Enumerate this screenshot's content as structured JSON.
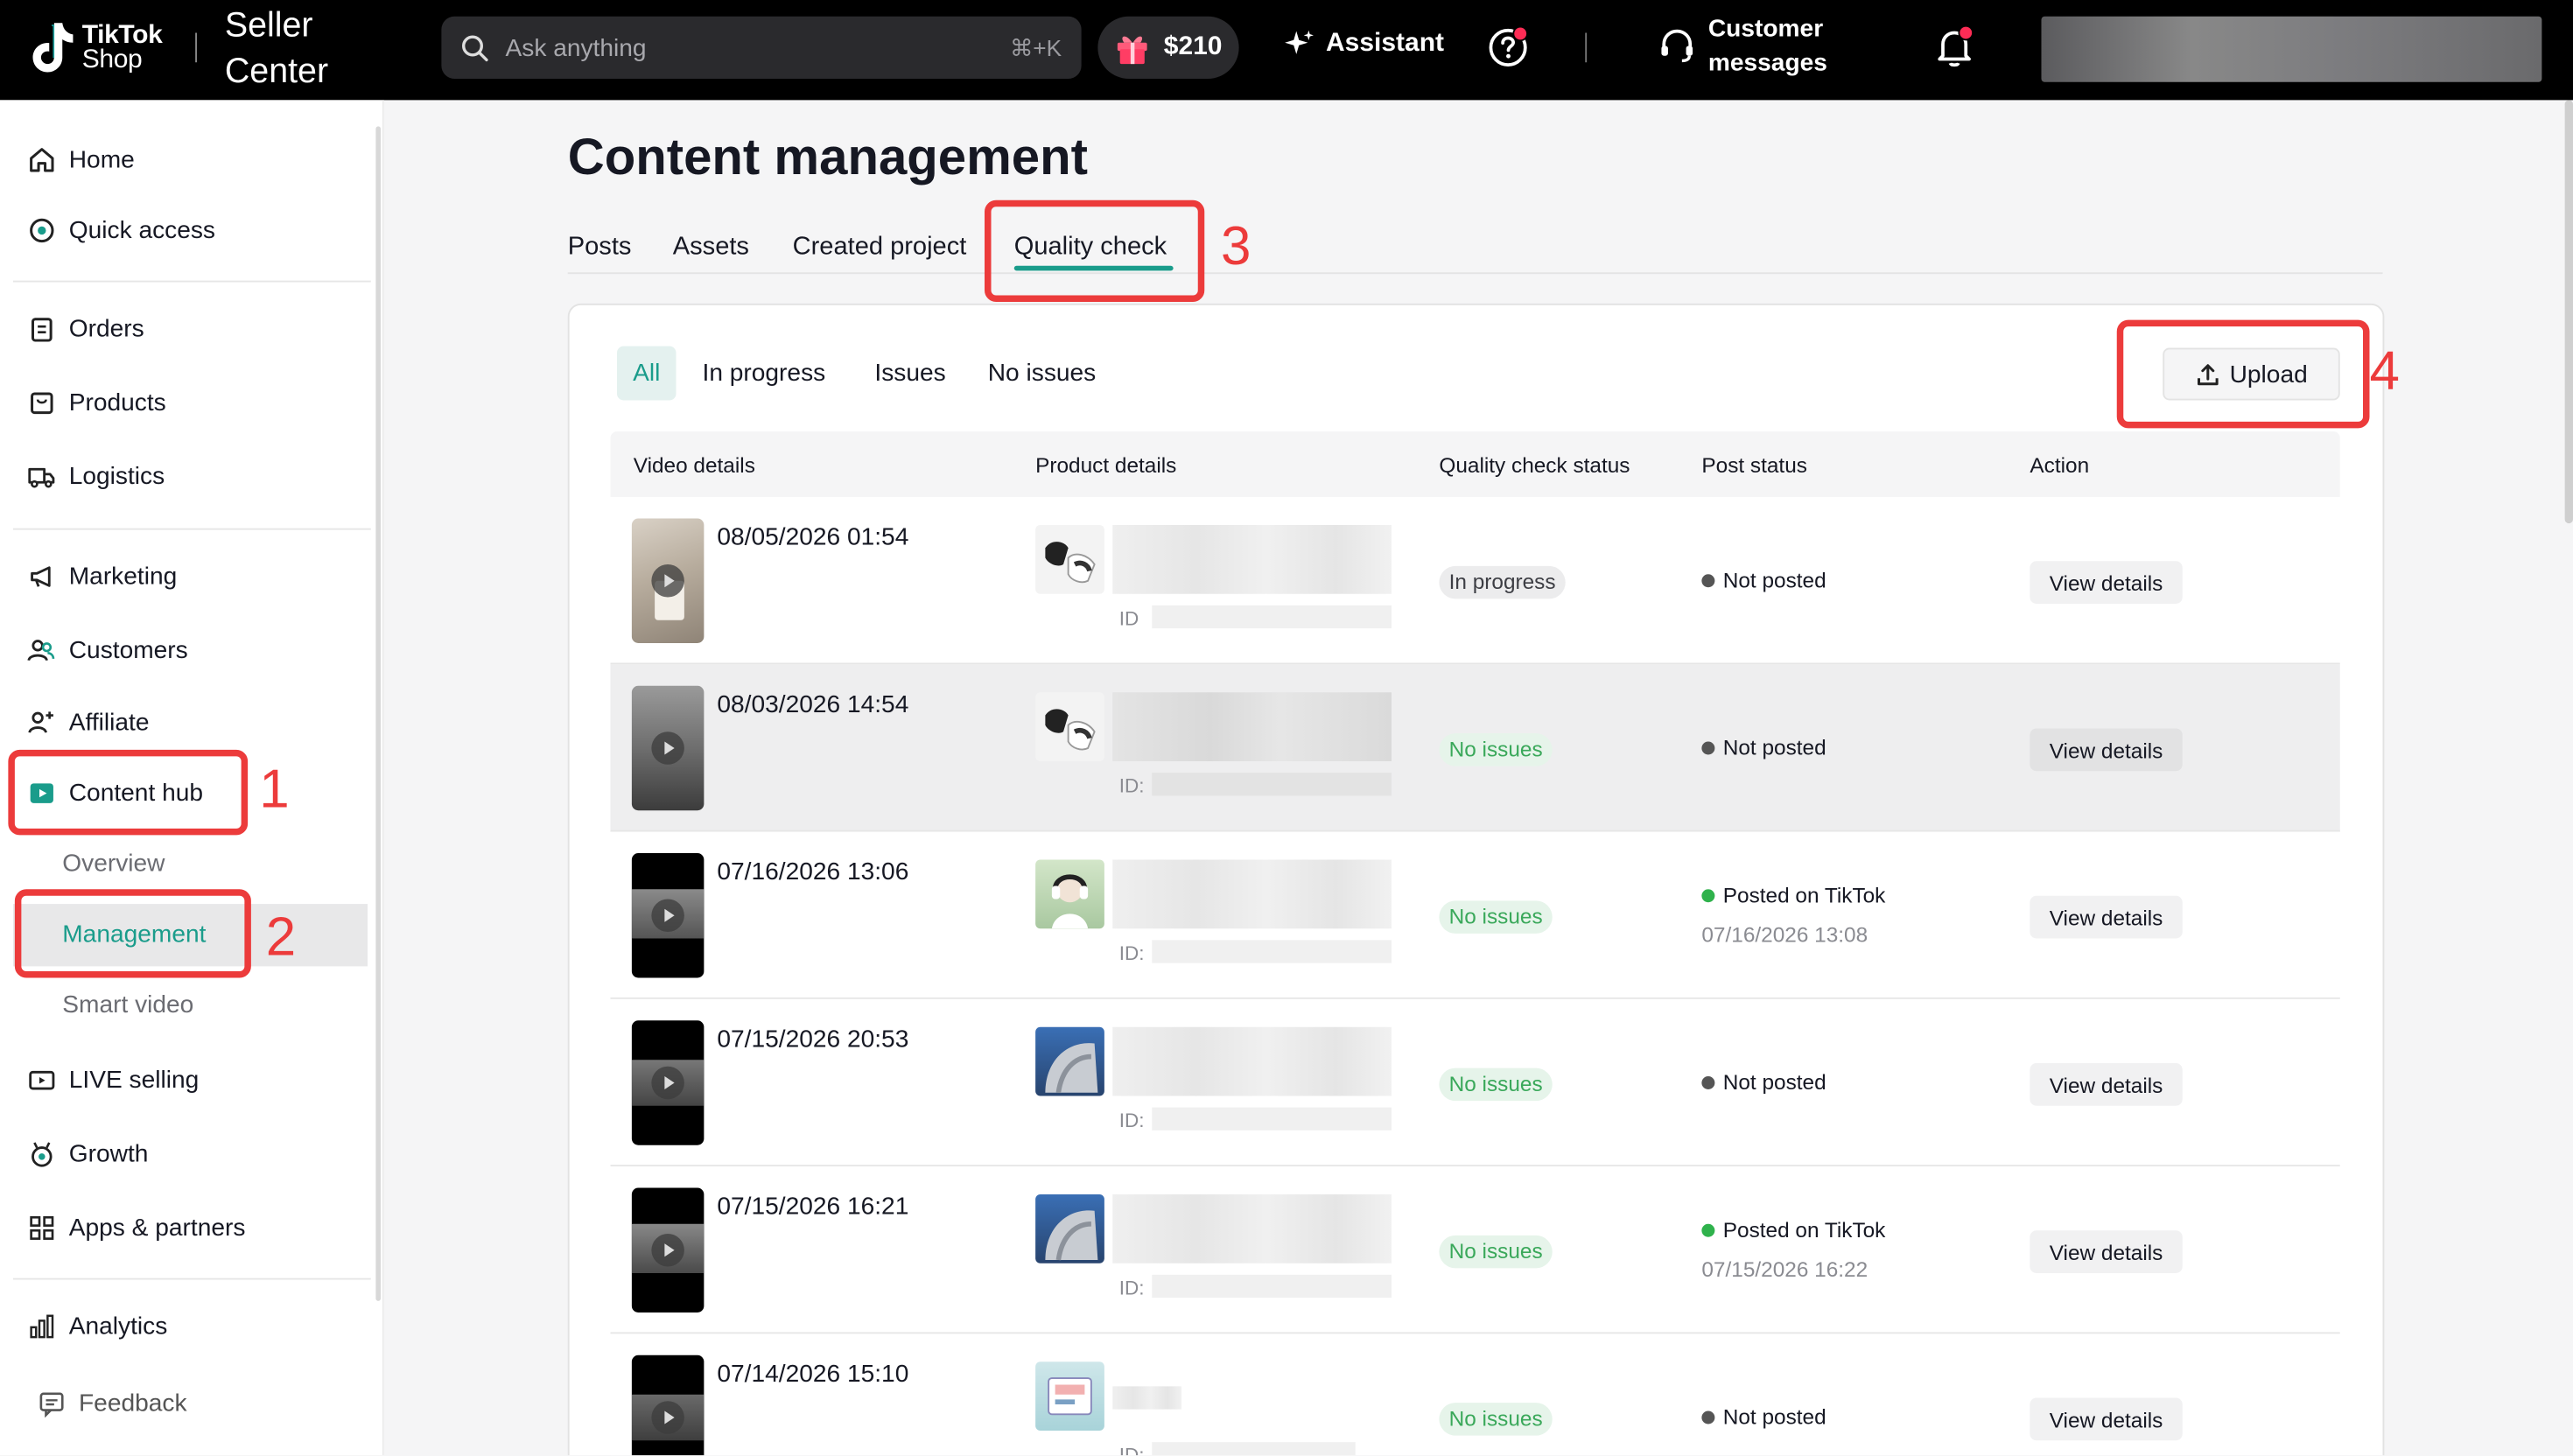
{
  "topbar": {
    "logo_line1": "TikTok",
    "logo_line2": "Shop",
    "seller_center_line1": "Seller",
    "seller_center_line2": "Center",
    "search_placeholder": "Ask anything",
    "search_shortcut": "⌘+K",
    "balance": "$210",
    "assistant": "Assistant",
    "customer_messages_line1": "Customer",
    "customer_messages_line2": "messages"
  },
  "sidebar": {
    "home": "Home",
    "quick_access": "Quick access",
    "orders": "Orders",
    "products": "Products",
    "logistics": "Logistics",
    "marketing": "Marketing",
    "customers": "Customers",
    "affiliate": "Affiliate",
    "content_hub": "Content hub",
    "overview": "Overview",
    "management": "Management",
    "smart_video": "Smart video",
    "live_selling": "LIVE selling",
    "growth": "Growth",
    "apps_partners": "Apps & partners",
    "analytics": "Analytics",
    "feedback": "Feedback"
  },
  "annotations": [
    "1",
    "2",
    "3",
    "4"
  ],
  "main": {
    "title": "Content management",
    "tabs": [
      "Posts",
      "Assets",
      "Created project",
      "Quality check"
    ],
    "active_tab": "Quality check",
    "filters": [
      "All",
      "In progress",
      "Issues",
      "No issues"
    ],
    "active_filter": "All",
    "upload": "Upload",
    "columns": [
      "Video details",
      "Product details",
      "Quality check status",
      "Post status",
      "Action"
    ],
    "rows": [
      {
        "date": "08/05/2026 01:54",
        "id_label": "ID",
        "qc_status": "In progress",
        "post_status": "Not posted",
        "post_time": "",
        "action": "View details"
      },
      {
        "date": "08/03/2026 14:54",
        "id_label": "ID:",
        "qc_status": "No issues",
        "post_status": "Not posted",
        "post_time": "",
        "action": "View details"
      },
      {
        "date": "07/16/2026 13:06",
        "id_label": "ID:",
        "qc_status": "No issues",
        "post_status": "Posted on TikTok",
        "post_time": "07/16/2026 13:08",
        "action": "View details"
      },
      {
        "date": "07/15/2026 20:53",
        "id_label": "ID:",
        "qc_status": "No issues",
        "post_status": "Not posted",
        "post_time": "",
        "action": "View details"
      },
      {
        "date": "07/15/2026 16:21",
        "id_label": "ID:",
        "qc_status": "No issues",
        "post_status": "Posted on TikTok",
        "post_time": "07/15/2026 16:22",
        "action": "View details"
      },
      {
        "date": "07/14/2026 15:10",
        "id_label": "ID:",
        "qc_status": "No issues",
        "post_status": "Not posted",
        "post_time": "",
        "action": "View details"
      }
    ]
  },
  "colors": {
    "accent": "#1a9c8b",
    "annotation_red": "#ec3b3b",
    "status_no_issues": "#3aa85a",
    "posted_dot": "#2fb24c",
    "not_posted_dot": "#555555"
  }
}
